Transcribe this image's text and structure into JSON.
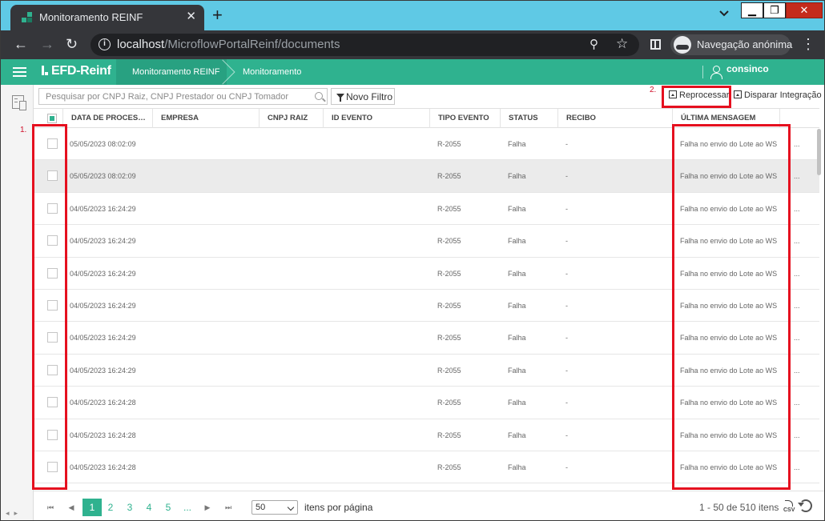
{
  "browser": {
    "tab_title": "Monitoramento REINF",
    "tab_close": "✕",
    "new_tab": "+",
    "url_host": "localhost",
    "url_path": "/MicroflowPortalReinf/documents",
    "incognito_label": "Navegação anónima",
    "window_buttons": {
      "minimize": "▁",
      "maximize": "❐",
      "close": "✕"
    }
  },
  "app": {
    "brand": "EFD-Reinf",
    "breadcrumbs": [
      "Monitoramento REINF",
      "Monitoramento"
    ],
    "user": "consinco",
    "accent_color": "#2fb28f"
  },
  "toolbar": {
    "search_placeholder": "Pesquisar por CNPJ Raiz, CNPJ Prestador ou CNPJ Tomador",
    "filter_label": "Novo Filtro",
    "reprocess_label": "Reprocessar",
    "trigger_label": "Disparar Integração"
  },
  "annotations": {
    "one": "1.",
    "two": "2."
  },
  "grid": {
    "columns": [
      "DATA DE PROCES…",
      "EMPRESA",
      "CNPJ RAIZ",
      "ID EVENTO",
      "TIPO EVENTO",
      "STATUS",
      "RECIBO",
      "ÚLTIMA MENSAGEM"
    ],
    "rows": [
      {
        "date": "05/05/2023 08:02:09",
        "empresa": "",
        "cnpj": "",
        "id": "",
        "tipo": "R-2055",
        "status": "Falha",
        "recibo": "-",
        "msg": "Falha no envio do Lote ao WS",
        "more": "..."
      },
      {
        "date": "05/05/2023 08:02:09",
        "empresa": "",
        "cnpj": "",
        "id": "",
        "tipo": "R-2055",
        "status": "Falha",
        "recibo": "-",
        "msg": "Falha no envio do Lote ao WS",
        "more": "..."
      },
      {
        "date": "04/05/2023 16:24:29",
        "empresa": "",
        "cnpj": "",
        "id": "",
        "tipo": "R-2055",
        "status": "Falha",
        "recibo": "-",
        "msg": "Falha no envio do Lote ao WS",
        "more": "..."
      },
      {
        "date": "04/05/2023 16:24:29",
        "empresa": "",
        "cnpj": "",
        "id": "",
        "tipo": "R-2055",
        "status": "Falha",
        "recibo": "-",
        "msg": "Falha no envio do Lote ao WS",
        "more": "..."
      },
      {
        "date": "04/05/2023 16:24:29",
        "empresa": "",
        "cnpj": "",
        "id": "",
        "tipo": "R-2055",
        "status": "Falha",
        "recibo": "-",
        "msg": "Falha no envio do Lote ao WS",
        "more": "..."
      },
      {
        "date": "04/05/2023 16:24:29",
        "empresa": "",
        "cnpj": "",
        "id": "",
        "tipo": "R-2055",
        "status": "Falha",
        "recibo": "-",
        "msg": "Falha no envio do Lote ao WS",
        "more": "..."
      },
      {
        "date": "04/05/2023 16:24:29",
        "empresa": "",
        "cnpj": "",
        "id": "",
        "tipo": "R-2055",
        "status": "Falha",
        "recibo": "-",
        "msg": "Falha no envio do Lote ao WS",
        "more": "..."
      },
      {
        "date": "04/05/2023 16:24:29",
        "empresa": "",
        "cnpj": "",
        "id": "",
        "tipo": "R-2055",
        "status": "Falha",
        "recibo": "-",
        "msg": "Falha no envio do Lote ao WS",
        "more": "..."
      },
      {
        "date": "04/05/2023 16:24:28",
        "empresa": "",
        "cnpj": "",
        "id": "",
        "tipo": "R-2055",
        "status": "Falha",
        "recibo": "-",
        "msg": "Falha no envio do Lote ao WS",
        "more": "..."
      },
      {
        "date": "04/05/2023 16:24:28",
        "empresa": "",
        "cnpj": "",
        "id": "",
        "tipo": "R-2055",
        "status": "Falha",
        "recibo": "-",
        "msg": "Falha no envio do Lote ao WS",
        "more": "..."
      },
      {
        "date": "04/05/2023 16:24:28",
        "empresa": "",
        "cnpj": "",
        "id": "",
        "tipo": "R-2055",
        "status": "Falha",
        "recibo": "-",
        "msg": "Falha no envio do Lote ao WS",
        "more": "..."
      }
    ],
    "selected_row_index": 1
  },
  "pager": {
    "first": "⏮",
    "prev": "◀",
    "pages": [
      "1",
      "2",
      "3",
      "4",
      "5",
      "..."
    ],
    "next": "▶",
    "last": "⏭",
    "page_size": "50",
    "per_page_label": "itens por página",
    "info": "1 - 50 de 510 itens",
    "csv_label": "CSV"
  }
}
